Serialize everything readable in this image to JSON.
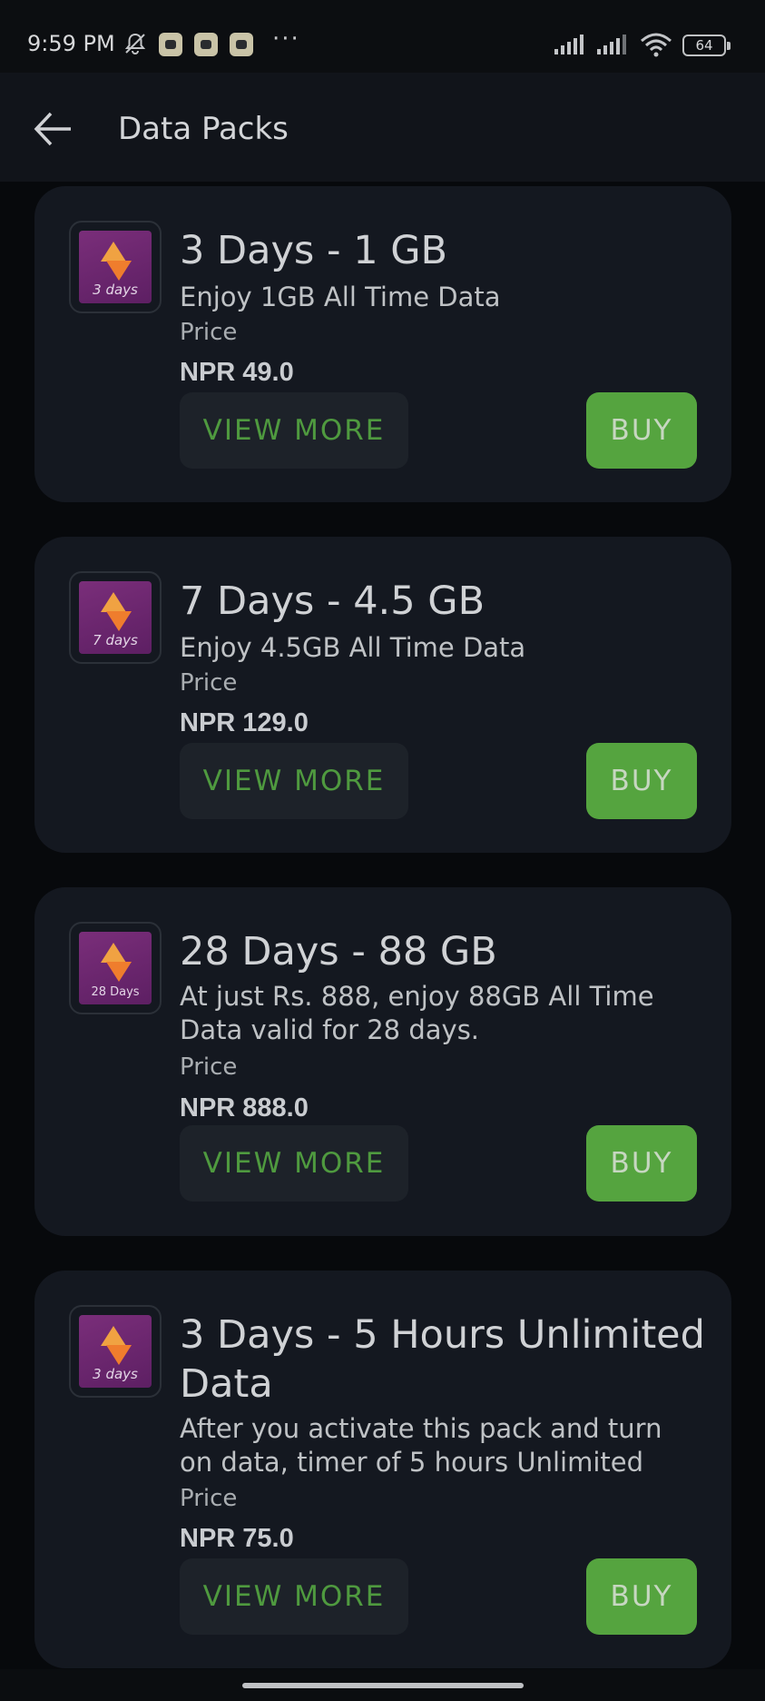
{
  "status_bar": {
    "time": "9:59 PM",
    "more_dots": "···",
    "battery": "64"
  },
  "app_bar": {
    "title": "Data Packs"
  },
  "packs": [
    {
      "thumb_label": "3 days",
      "title": "3 Days - 1 GB",
      "description": "Enjoy 1GB All Time Data",
      "price_label": "Price",
      "price": "NPR 49.0",
      "view_more": "VIEW MORE",
      "buy": "BUY"
    },
    {
      "thumb_label": "7 days",
      "title": "7 Days - 4.5 GB",
      "description": "Enjoy 4.5GB All Time Data",
      "price_label": "Price",
      "price": "NPR 129.0",
      "view_more": "VIEW MORE",
      "buy": "BUY"
    },
    {
      "thumb_label": "28 Days",
      "title": "28 Days - 88 GB",
      "description_line1": "At just Rs. 888, enjoy 88GB All Time",
      "description_line2": "Data valid for 28 days.",
      "price_label": "Price",
      "price": "NPR 888.0",
      "view_more": "VIEW MORE",
      "buy": "BUY"
    },
    {
      "thumb_label": "3 days",
      "title_line1": "3 Days - 5 Hours Unlimited",
      "title_line2": "Data",
      "description_line1": "After you activate this pack and turn",
      "description_line2": "on data, timer of 5 hours Unlimited",
      "price_label": "Price",
      "price": "NPR 75.0",
      "view_more": "VIEW MORE",
      "buy": "BUY"
    }
  ],
  "colors": {
    "background": "#07090c",
    "card": "#141820",
    "accent_green": "#55a43f",
    "thumb_purple": "#7a2e7a",
    "thumb_orange": "#f0a242"
  },
  "icons": [
    "back-arrow-icon",
    "bell-off-icon",
    "signal-icon",
    "wifi-icon",
    "battery-icon"
  ]
}
